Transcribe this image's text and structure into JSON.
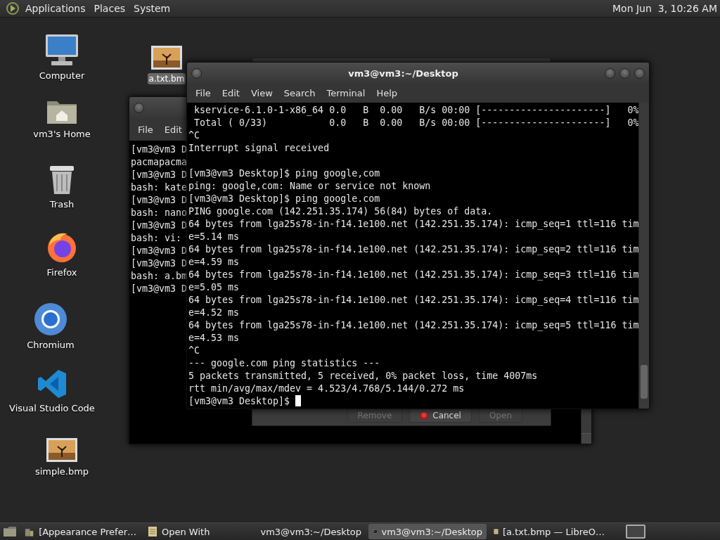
{
  "top_panel": {
    "menus": [
      "Applications",
      "Places",
      "System"
    ],
    "clock": "Mon Jun  3, 10:26 AM"
  },
  "desktop_icons": [
    {
      "label": "Computer",
      "kind": "computer",
      "selected": false
    },
    {
      "label": "vm3's Home",
      "kind": "home",
      "selected": false
    },
    {
      "label": "Trash",
      "kind": "trash",
      "selected": false
    },
    {
      "label": "Firefox",
      "kind": "firefox",
      "selected": false
    },
    {
      "label": "Chromium",
      "kind": "chromium",
      "selected": false
    },
    {
      "label": "Visual Studio Code",
      "kind": "vscode",
      "selected": false
    },
    {
      "label": "simple.bmp",
      "kind": "image",
      "selected": false
    },
    {
      "label": "a.txt.bm",
      "kind": "image",
      "selected": true
    }
  ],
  "back_terminal": {
    "menus": [
      "File",
      "Edit"
    ],
    "lines": [
      "[vm3@vm3 D",
      "pacmapacma",
      "[vm3@vm3 D",
      "bash: kate",
      "[vm3@vm3 D",
      "bash: nano",
      "[vm3@vm3 D",
      "bash: vi:",
      "[vm3@vm3 D",
      "[vm3@vm3 D",
      "bash: a.bm",
      "[vm3@vm3 D"
    ]
  },
  "dialog": {
    "buttons": [
      {
        "label": "Remove",
        "disabled": true
      },
      {
        "label": "Cancel",
        "disabled": false
      },
      {
        "label": "Open",
        "disabled": true
      }
    ]
  },
  "front_terminal": {
    "title": "vm3@vm3:~/Desktop",
    "menus": [
      "File",
      "Edit",
      "View",
      "Search",
      "Terminal",
      "Help"
    ],
    "lines": [
      " kservice-6.1.0-1-x86_64 0.0   B  0.00   B/s 00:00 [----------------------]   0%",
      " Total ( 0/33)           0.0   B  0.00   B/s 00:00 [----------------------]   0%",
      "^C",
      "Interrupt signal received"
    ],
    "lines_after_gap": [
      "[vm3@vm3 Desktop]$ ping google,com",
      "ping: google,com: Name or service not known",
      "[vm3@vm3 Desktop]$ ping google.com",
      "PING google.com (142.251.35.174) 56(84) bytes of data.",
      "64 bytes from lga25s78-in-f14.1e100.net (142.251.35.174): icmp_seq=1 ttl=116 tim",
      "e=5.14 ms",
      "64 bytes from lga25s78-in-f14.1e100.net (142.251.35.174): icmp_seq=2 ttl=116 tim",
      "e=4.59 ms",
      "64 bytes from lga25s78-in-f14.1e100.net (142.251.35.174): icmp_seq=3 ttl=116 tim",
      "e=5.05 ms",
      "64 bytes from lga25s78-in-f14.1e100.net (142.251.35.174): icmp_seq=4 ttl=116 tim",
      "e=4.52 ms",
      "64 bytes from lga25s78-in-f14.1e100.net (142.251.35.174): icmp_seq=5 ttl=116 tim",
      "e=4.53 ms",
      "^C",
      "--- google.com ping statistics ---",
      "5 packets transmitted, 5 received, 0% packet loss, time 4007ms",
      "rtt min/avg/max/mdev = 4.523/4.768/5.144/0.272 ms",
      "[vm3@vm3 Desktop]$ "
    ]
  },
  "taskbar": {
    "items": [
      {
        "label": "[Appearance Prefer…",
        "kind": "prefs",
        "selected": false
      },
      {
        "label": "Open With",
        "kind": "doc",
        "selected": false
      },
      {
        "label": "vm3@vm3:~/Desktop",
        "kind": "terminal",
        "selected": false
      },
      {
        "label": "vm3@vm3:~/Desktop",
        "kind": "terminal",
        "selected": true
      },
      {
        "label": "[a.txt.bmp — LibreO…",
        "kind": "doc",
        "selected": false
      }
    ]
  }
}
